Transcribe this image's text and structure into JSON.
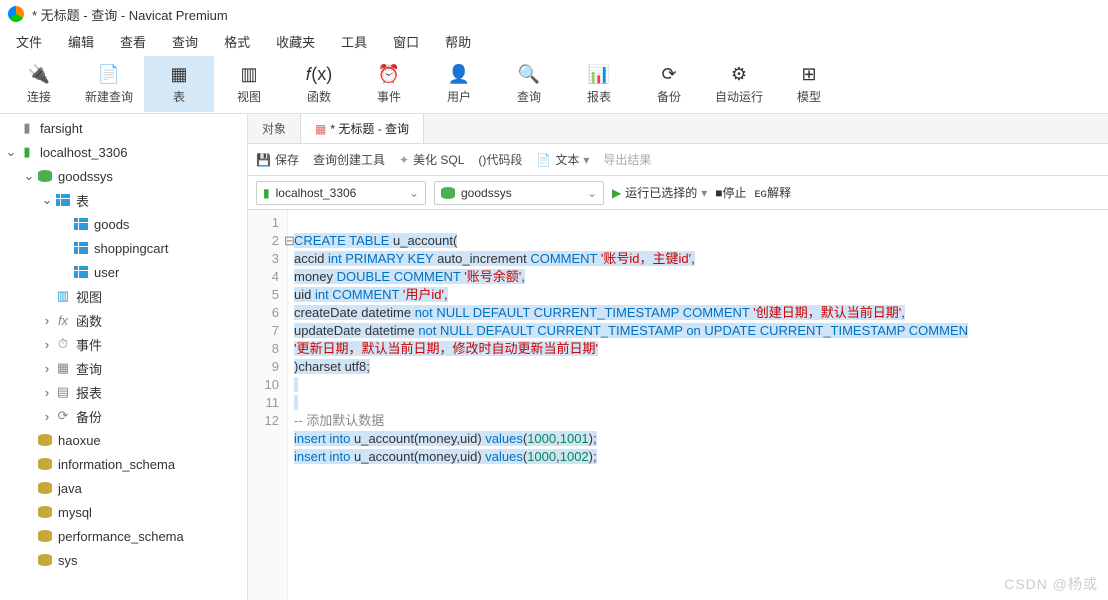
{
  "window": {
    "title": "* 无标题 - 查询 - Navicat Premium"
  },
  "menu": [
    "文件",
    "编辑",
    "查看",
    "查询",
    "格式",
    "收藏夹",
    "工具",
    "窗口",
    "帮助"
  ],
  "toolbar": [
    {
      "label": "连接",
      "icon": "plug"
    },
    {
      "label": "新建查询",
      "icon": "newq"
    },
    {
      "label": "表",
      "icon": "table",
      "active": true
    },
    {
      "label": "视图",
      "icon": "view"
    },
    {
      "label": "函数",
      "icon": "func"
    },
    {
      "label": "事件",
      "icon": "event"
    },
    {
      "label": "用户",
      "icon": "user"
    },
    {
      "label": "查询",
      "icon": "query"
    },
    {
      "label": "报表",
      "icon": "report"
    },
    {
      "label": "备份",
      "icon": "backup"
    },
    {
      "label": "自动运行",
      "icon": "auto"
    },
    {
      "label": "模型",
      "icon": "model"
    }
  ],
  "tree": [
    {
      "d": 0,
      "arrow": "",
      "icon": "conn",
      "label": "farsight"
    },
    {
      "d": 0,
      "arrow": "v",
      "icon": "conn-g",
      "label": "localhost_3306"
    },
    {
      "d": 1,
      "arrow": "v",
      "icon": "db-g",
      "label": "goodssys"
    },
    {
      "d": 2,
      "arrow": "v",
      "icon": "tbl",
      "label": "表"
    },
    {
      "d": 3,
      "arrow": "",
      "icon": "tbl",
      "label": "goods"
    },
    {
      "d": 3,
      "arrow": "",
      "icon": "tbl",
      "label": "shoppingcart"
    },
    {
      "d": 3,
      "arrow": "",
      "icon": "tbl",
      "label": "user"
    },
    {
      "d": 2,
      "arrow": "",
      "icon": "view",
      "label": "视图"
    },
    {
      "d": 2,
      "arrow": ">",
      "icon": "fx",
      "label": "函数"
    },
    {
      "d": 2,
      "arrow": ">",
      "icon": "evt",
      "label": "事件"
    },
    {
      "d": 2,
      "arrow": ">",
      "icon": "qry",
      "label": "查询"
    },
    {
      "d": 2,
      "arrow": ">",
      "icon": "rpt",
      "label": "报表"
    },
    {
      "d": 2,
      "arrow": ">",
      "icon": "bkp",
      "label": "备份"
    },
    {
      "d": 1,
      "arrow": "",
      "icon": "db",
      "label": "haoxue"
    },
    {
      "d": 1,
      "arrow": "",
      "icon": "db",
      "label": "information_schema"
    },
    {
      "d": 1,
      "arrow": "",
      "icon": "db",
      "label": "java"
    },
    {
      "d": 1,
      "arrow": "",
      "icon": "db",
      "label": "mysql"
    },
    {
      "d": 1,
      "arrow": "",
      "icon": "db",
      "label": "performance_schema"
    },
    {
      "d": 1,
      "arrow": "",
      "icon": "db",
      "label": "sys"
    }
  ],
  "tabs": {
    "obj": "对象",
    "queryTab": "* 无标题 - 查询"
  },
  "qtoolbar": {
    "save": "保存",
    "builder": "查询创建工具",
    "beautify": "美化 SQL",
    "snippet": "()代码段",
    "text": "文本",
    "export": "导出结果"
  },
  "connbar": {
    "conn": "localhost_3306",
    "db": "goodssys",
    "run": "运行已选择的",
    "stop": "停止",
    "explain": "解释"
  },
  "code": {
    "lines": [
      "1",
      "2",
      "3",
      "4",
      "5",
      "6",
      "7",
      "8",
      "9",
      "10",
      "11",
      "12"
    ],
    "l1": {
      "a": "CREATE TABLE",
      "b": " u_account("
    },
    "l2": {
      "a": "accid ",
      "b": "int PRIMARY KEY",
      "c": " auto_increment ",
      "d": "COMMENT ",
      "e": "'账号id，主键id'",
      "f": ","
    },
    "l3": {
      "a": "money ",
      "b": "DOUBLE COMMENT ",
      "c": "'账号余额'",
      "d": ","
    },
    "l4": {
      "a": "uid ",
      "b": "int COMMENT ",
      "c": "'用户id'",
      "d": ","
    },
    "l5": {
      "a": "createDate datetime ",
      "b": "not NULL DEFAULT CURRENT_TIMESTAMP COMMENT ",
      "c": "'创建日期，默认当前日期'",
      "d": ","
    },
    "l6": {
      "a": "updateDate datetime ",
      "b": "not NULL DEFAULT CURRENT_TIMESTAMP on UPDATE CURRENT_TIMESTAMP COMMEN"
    },
    "l6b": {
      "a": "'更新日期，默认当前日期，修改时自动更新当前日期'"
    },
    "l7": {
      "a": ")charset utf8;"
    },
    "l10": {
      "a": "-- 添加默认数据"
    },
    "l11": {
      "a": "insert into",
      "b": " u_account(money,uid) ",
      "c": "values",
      "d": "(",
      "e": "1000",
      "f": ",",
      "g": "1001",
      "h": ");"
    },
    "l12": {
      "a": "insert into",
      "b": " u_account(money,uid) ",
      "c": "values",
      "d": "(",
      "e": "1000",
      "f": ",",
      "g": "1002",
      "h": ");"
    }
  },
  "watermark": "CSDN @杨或"
}
